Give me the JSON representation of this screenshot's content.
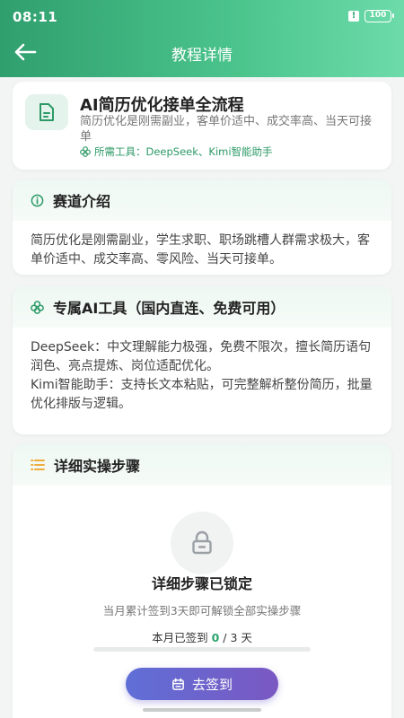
{
  "status_bar": {
    "time": "08:11",
    "battery": "100",
    "alert_icon": "alert-icon"
  },
  "nav": {
    "title": "教程详情",
    "back_icon": "arrow-left-icon"
  },
  "intro": {
    "icon": "document-icon",
    "title": "AI简历优化接单全流程",
    "description": "简历优化是刚需副业，客单价适中、成交率高、当天可接单",
    "tools_icon": "flower-icon",
    "tools": "所需工具：DeepSeek、Kimi智能助手"
  },
  "track": {
    "icon": "info-icon",
    "title": "赛道介绍",
    "body": "简历优化是刚需副业，学生求职、职场跳槽人群需求极大，客单价适中、成交率高、零风险、当天可接单。"
  },
  "tools": {
    "icon": "flower-icon",
    "title": "专属AI工具（国内直连、免费可用）",
    "items": [
      "DeepSeek：中文理解能力极强，免费不限次，擅长简历语句润色、亮点提炼、岗位适配优化。",
      "Kimi智能助手：支持长文本粘贴，可完整解析整份简历，批量优化排版与逻辑。"
    ]
  },
  "steps": {
    "icon": "list-icon",
    "title": "详细实操步骤",
    "lock_icon": "lock-icon",
    "lock_title": "详细步骤已锁定",
    "lock_desc": "当月累计签到3天即可解锁全部实操步骤",
    "progress_prefix": "本月已签到 ",
    "progress_count": "0",
    "progress_suffix": " / 3 天",
    "progress_fraction": 0
  },
  "checkin_button": {
    "icon": "calendar-icon",
    "label": "去签到"
  },
  "colors": {
    "accent": "#36b07a",
    "button_start": "#5f6fd6",
    "button_end": "#7a58c2"
  }
}
